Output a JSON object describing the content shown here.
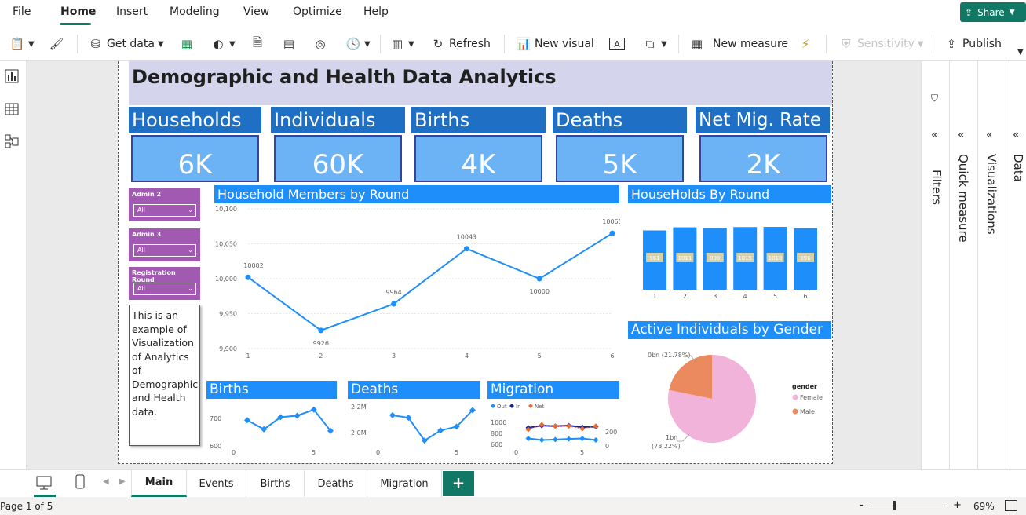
{
  "menu": {
    "items": [
      "File",
      "Home",
      "Insert",
      "Modeling",
      "View",
      "Optimize",
      "Help"
    ],
    "share": "Share"
  },
  "ribbon": {
    "get_data": "Get data",
    "refresh": "Refresh",
    "new_visual": "New visual",
    "new_measure": "New measure",
    "sensitivity": "Sensitivity",
    "publish": "Publish"
  },
  "report": {
    "title": "Demographic and Health Data Analytics",
    "kpis": [
      {
        "label": "Households",
        "value": "6K"
      },
      {
        "label": "Individuals",
        "value": "60K"
      },
      {
        "label": "Births",
        "value": "4K"
      },
      {
        "label": "Deaths",
        "value": "5K"
      },
      {
        "label": "Net Mig. Rate",
        "value": "2K"
      }
    ],
    "slicers": [
      {
        "label": "Admin 2",
        "value": "All"
      },
      {
        "label": "Admin 3",
        "value": "All"
      },
      {
        "label": "Registration Round",
        "value": "All"
      }
    ],
    "textbox": "This is an example of Visualization of Analytics of Demographic and Health data.",
    "visual_titles": {
      "members": "Household Members by Round",
      "households": "HouseHolds By Round",
      "gender": "Active Individuals by Gender",
      "births": "Births",
      "deaths": "Deaths",
      "migration": "Migration"
    }
  },
  "chart_data": [
    {
      "type": "line",
      "title": "Household Members by Round",
      "x": [
        1,
        2,
        3,
        4,
        5,
        6
      ],
      "values": [
        10002,
        9926,
        9964,
        10043,
        10000,
        10065
      ],
      "data_labels": [
        "10002",
        "9926",
        "9964",
        "10043",
        "10000",
        "10065"
      ],
      "y_ticks": [
        "10,100",
        "10,050",
        "10,000",
        "9,950",
        "9,900"
      ],
      "ylim": [
        9900,
        10100
      ],
      "color": "#1e8ffa"
    },
    {
      "type": "bar",
      "title": "HouseHolds By Round",
      "categories": [
        "1",
        "2",
        "3",
        "4",
        "5",
        "6"
      ],
      "values": [
        961,
        1011,
        999,
        1015,
        1018,
        996
      ],
      "data_labels": [
        "961",
        "1011",
        "999",
        "1015",
        "1018",
        "996"
      ],
      "color": "#1e8ffa"
    },
    {
      "type": "pie",
      "title": "Active Individuals by Gender",
      "legend_title": "gender",
      "legend": [
        "Female",
        "Male"
      ],
      "values": [
        78.22,
        21.78
      ],
      "data_labels": [
        "1bn",
        "(78.22%)",
        "0bn (21.78%)"
      ],
      "colors": [
        "#f2b3da",
        "#eb8a5e"
      ]
    },
    {
      "type": "line",
      "title": "Births",
      "x": [
        0,
        1,
        2,
        3,
        4,
        5,
        6
      ],
      "values": [
        670,
        640,
        680,
        685,
        705,
        635
      ],
      "y_ticks": [
        "700",
        "600"
      ],
      "x_ticks": [
        "0",
        "5"
      ],
      "color": "#1e8ffa"
    },
    {
      "type": "line",
      "title": "Deaths",
      "values": [
        2.16,
        2.14,
        1.96,
        2.04,
        2.07,
        2.2
      ],
      "y_ticks": [
        "2.2M",
        "2.0M"
      ],
      "x_ticks": [
        "0",
        "5"
      ],
      "color": "#1e8ffa"
    },
    {
      "type": "line",
      "title": "Migration",
      "legend": [
        "Out",
        "In",
        "Net"
      ],
      "y_ticks": [
        "1000",
        "800",
        "600"
      ],
      "y2_ticks": [
        "200",
        "0"
      ],
      "x_ticks": [
        "0",
        "5"
      ],
      "series": [
        {
          "name": "Out",
          "values": [
            720,
            690,
            700,
            710,
            720,
            690
          ]
        },
        {
          "name": "In",
          "values": [
            920,
            960,
            950,
            960,
            930,
            940
          ]
        },
        {
          "name": "Net",
          "values": [
            200,
            270,
            250,
            250,
            210,
            250
          ]
        }
      ],
      "colors": [
        "#1e8ffa",
        "#12239e",
        "#e66c37"
      ]
    }
  ],
  "panes": {
    "filters": "Filters",
    "quick_measure": "Quick measure",
    "visualizations": "Visualizations",
    "data": "Data"
  },
  "tabs": [
    "Main",
    "Events",
    "Births",
    "Deaths",
    "Migration"
  ],
  "status": {
    "page": "Page 1 of 5",
    "zoom": "69%",
    "minus": "-",
    "plus": "+"
  },
  "colors": {
    "accent": "#117865",
    "kpi_head": "#1f6fc5",
    "kpi_box": "#6cb3f5",
    "visual_head": "#1e8ffa",
    "slicer": "#a159b2"
  }
}
